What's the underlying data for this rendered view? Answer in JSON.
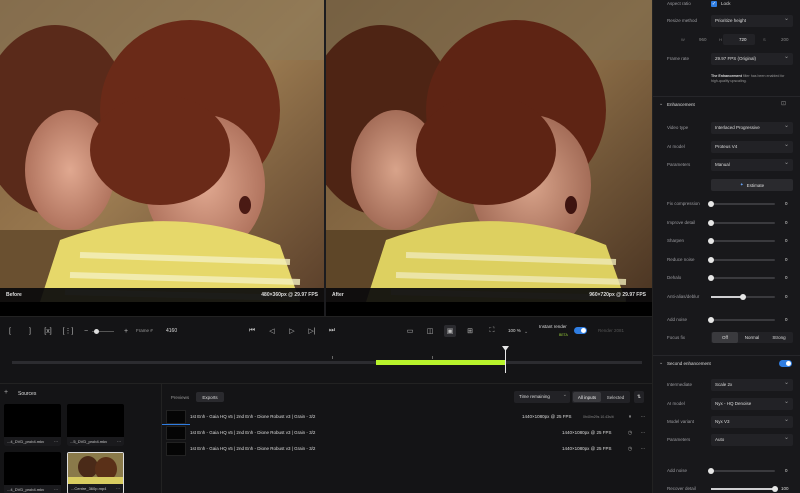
{
  "preview": {
    "before_label": "Before",
    "before_res": "480×360px @ 29.97 FPS",
    "after_label": "After",
    "after_res": "960×720px @ 29.97 FPS"
  },
  "transport": {
    "frame_label": "Frame #",
    "frame_value": "4160",
    "zoom": "100 %",
    "instant_render_label": "Instant render",
    "instant_render_badge": "BETA",
    "render_label": "Render 2081"
  },
  "sources": {
    "title": "Sources",
    "add_icon": "plus-icon",
    "items": [
      {
        "label": "...4_DVD_prob4.mkv"
      },
      {
        "label": "...5_DVD_prob4.mkv"
      },
      {
        "label": "...4_DVD_prob4.mkv"
      },
      {
        "label": "...Centre_360p.mp4"
      }
    ]
  },
  "exports_panel": {
    "tabs": [
      "Previews",
      "Exports"
    ],
    "sort_select": "Time remaining",
    "filter_all": "All inputs",
    "filter_selected": "Selected",
    "rows": [
      {
        "name": "1st Enh - Gaia HQ v5  |  2nd Enh - Dione Robust v3  |  Grain - 3/2",
        "res": "1440×1080px @ 25 FPS",
        "eta": "0h40m29s 10.43s/it"
      },
      {
        "name": "1st Enh - Gaia HQ v5  |  2nd Enh - Dione Robust v3  |  Grain - 3/2",
        "res": "1440×1080px @ 25 FPS",
        "eta": ""
      },
      {
        "name": "1st Enh - Gaia HQ v5  |  2nd Enh - Dione Robust v3  |  Grain - 3/2",
        "res": "1440×1080px @ 25 FPS",
        "eta": ""
      }
    ]
  },
  "panel": {
    "aspect_ratio_label": "Aspect ratio",
    "lock_label": "Lock",
    "resize_method_label": "Resize method",
    "resize_method_value": "Prioritize height",
    "dims": {
      "w_label": "W",
      "w": "960",
      "h_label": "H",
      "h": "720",
      "s_label": "S",
      "s": "200"
    },
    "frame_rate_label": "Frame rate",
    "frame_rate_value": "29.97 FPS (Original)",
    "note_bold": "The Enhancement",
    "note_rest": " filter has been enabled for high-quality upscaling.",
    "enhancement": {
      "title": "Enhancement",
      "video_type_label": "Video type",
      "video_type_value": "Interlaced Progressive",
      "ai_model_label": "AI model",
      "ai_model_value": "Proteus V4",
      "parameters_label": "Parameters",
      "parameters_value": "Manual",
      "estimate_label": "Estimate",
      "sliders": [
        {
          "label": "Fix compression",
          "value": "0",
          "level": 0
        },
        {
          "label": "Improve detail",
          "value": "0",
          "level": 0
        },
        {
          "label": "Sharpen",
          "value": "0",
          "level": 0
        },
        {
          "label": "Reduce noise",
          "value": "0",
          "level": 0
        },
        {
          "label": "Dehalo",
          "value": "0",
          "level": 0
        },
        {
          "label": "Anti-alias/deblur",
          "value": "0",
          "level": 0.5
        }
      ],
      "add_noise_label": "Add noise",
      "add_noise_value": "0",
      "add_noise_level": 0,
      "focus_fix_label": "Focus fix",
      "focus_options": [
        "Off",
        "Normal",
        "Strong"
      ],
      "focus_selected": "Off"
    },
    "second": {
      "title": "Second enhancement",
      "intermediate_label": "Intermediate",
      "intermediate_value": "Scale 2x",
      "ai_model_label": "AI model",
      "ai_model_value": "Nyx - HQ Denoise",
      "model_variant_label": "Model variant",
      "model_variant_value": "Nyx V3",
      "parameters_label": "Parameters",
      "parameters_value": "Auto",
      "add_noise_label": "Add noise",
      "add_noise_value": "0",
      "add_noise_level": 0,
      "recover_detail_label": "Recover detail",
      "recover_detail_value": "100",
      "recover_detail_level": 1
    }
  },
  "colors": {
    "accent": "#2f7de1",
    "timeline_selection": "#b8f32c"
  }
}
